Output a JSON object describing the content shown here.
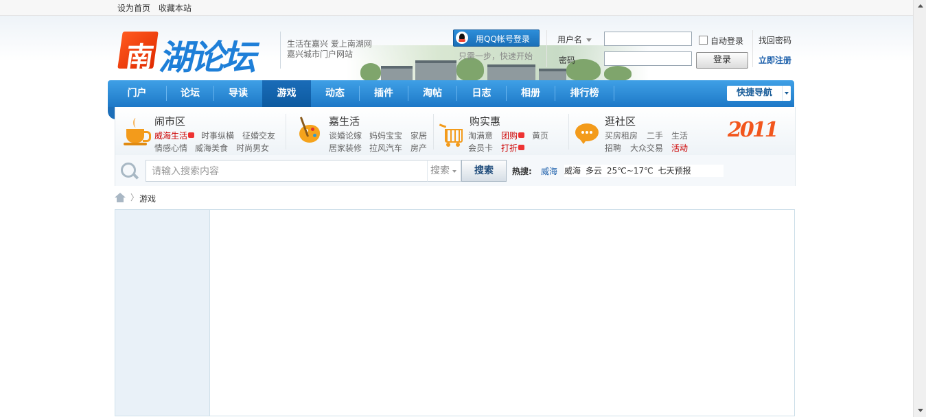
{
  "topbar": {
    "set_home": "设为首页",
    "bookmark": "收藏本站"
  },
  "header": {
    "logo_seal_char": "南",
    "logo_text": "湖论坛",
    "slogan_line1": "生活在嘉兴  爱上南湖网",
    "slogan_line2": "嘉兴城市门户网站"
  },
  "login": {
    "qq_button": "用QQ帐号登录",
    "qq_hint": "只需一步，快速开始",
    "username_label": "用户名",
    "password_label": "密码",
    "auto_login": "自动登录",
    "login_button": "登录",
    "find_password": "找回密码",
    "register": "立即注册"
  },
  "nav": {
    "items": [
      "门户",
      "论坛",
      "导读",
      "游戏",
      "动态",
      "插件",
      "淘帖",
      "日志",
      "相册",
      "排行榜"
    ],
    "active": "游戏",
    "quick_nav": "快捷导航"
  },
  "categories": [
    {
      "title": "闹市区",
      "links": [
        [
          "威海生活",
          "时事纵横",
          "征婚交友"
        ],
        [
          "情感心情",
          "威海美食",
          "时尚男女"
        ]
      ]
    },
    {
      "title": "嘉生活",
      "links": [
        [
          "谈婚论嫁",
          "妈妈宝宝",
          "家居"
        ],
        [
          "居家装修",
          "拉风汽车",
          "房产"
        ]
      ]
    },
    {
      "title": "购实惠",
      "links": [
        [
          "淘满意",
          "团购",
          "黄页"
        ],
        [
          "会员卡",
          "打折"
        ]
      ]
    },
    {
      "title": "逛社区",
      "links": [
        [
          "买房租房",
          "二手",
          "生活"
        ],
        [
          "招聘",
          "大众交易",
          "活动"
        ]
      ]
    }
  ],
  "badge": "2011",
  "search": {
    "placeholder": "请输入搜索内容",
    "scope": "搜索",
    "button": "搜索",
    "hot_label": "热搜:",
    "hot_item": "威海"
  },
  "weather": {
    "city": "威海",
    "condition": "多云",
    "temp": "25℃~17℃",
    "forecast": "七天预报"
  },
  "breadcrumb": {
    "separator": "〉",
    "current": "游戏"
  },
  "colors": {
    "nav_blue": "#1d78c7",
    "accent_orange": "#f39b1b",
    "hot_red": "#cc0000",
    "link_blue": "#1a5eaa"
  }
}
